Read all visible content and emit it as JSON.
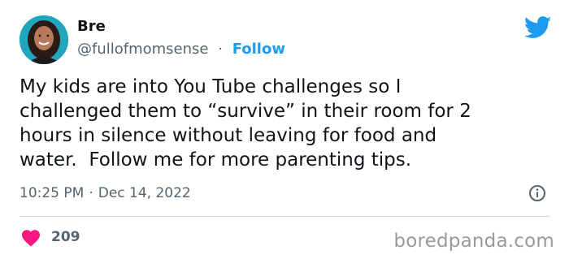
{
  "author": {
    "name": "Bre",
    "handle": "@fullofmomsense",
    "separator": "·",
    "follow_label": "Follow",
    "avatar_icon": "profile-photo"
  },
  "tweet": {
    "text": "My kids are into You Tube challenges so I\nchallenged them to “survive” in their room for 2\nhours in silence without leaving for food and\nwater.  Follow me for more parenting tips.",
    "time": "10:25 PM",
    "date": "Dec 14, 2022",
    "separator": "·"
  },
  "engagement": {
    "likes": "209",
    "like_icon": "heart-icon"
  },
  "brand": {
    "icon": "twitter-bird-icon",
    "color": "#1d9bf0"
  },
  "watermark": "boredpanda.com"
}
